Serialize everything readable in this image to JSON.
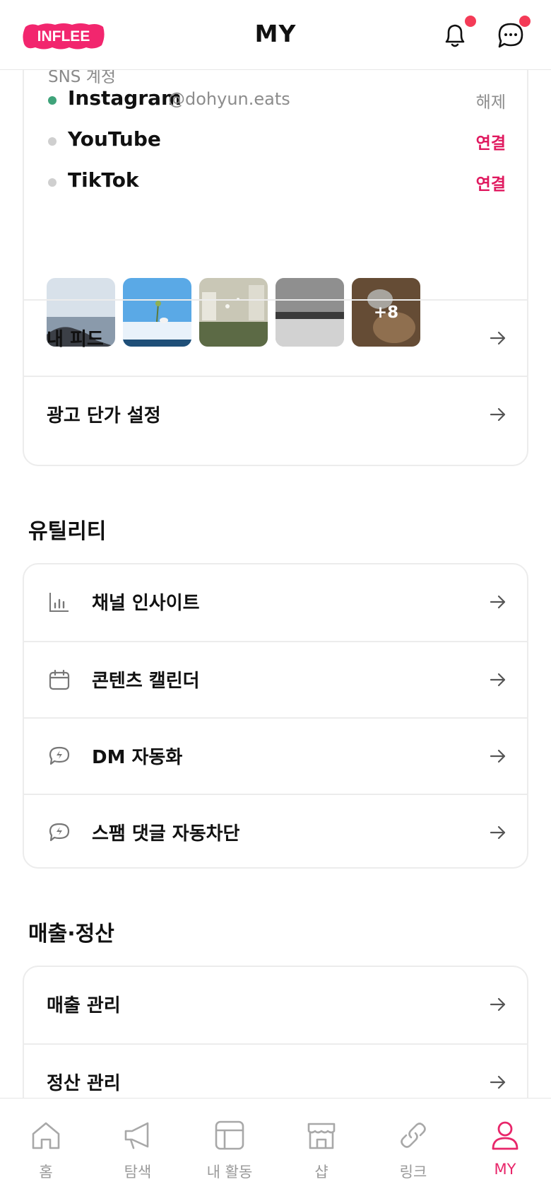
{
  "header": {
    "logo_text": "INFLEE",
    "title": "MY",
    "bell_icon": "bell-icon",
    "chat_icon": "chat-bubble-icon",
    "badge_color": "#f43b57"
  },
  "sns": {
    "label": "SNS 계정",
    "accounts": [
      {
        "name": "Instagram",
        "handle": "@dohyun.eats",
        "action": "해제",
        "connected": true
      },
      {
        "name": "YouTube",
        "handle": "",
        "action": "연결",
        "connected": false
      },
      {
        "name": "TikTok",
        "handle": "",
        "action": "연결",
        "connected": false
      }
    ],
    "more_count": "+8",
    "menu": [
      {
        "label": "내 피드"
      },
      {
        "label": "광고 단가 설정"
      }
    ]
  },
  "utility": {
    "title": "유틸리티",
    "items": [
      {
        "label": "채널 인사이트",
        "icon": "bar-chart-icon"
      },
      {
        "label": "콘텐츠 캘린더",
        "icon": "calendar-icon"
      },
      {
        "label": "DM 자동화",
        "icon": "lightning-chat-icon"
      },
      {
        "label": "스팸 댓글 자동차단",
        "icon": "lightning-chat-icon"
      }
    ]
  },
  "sales": {
    "title": "매출·정산",
    "items": [
      {
        "label": "매출 관리"
      },
      {
        "label": "정산 관리"
      }
    ]
  },
  "tabbar": {
    "active_color": "#e8266a",
    "tabs": [
      {
        "label": "홈",
        "icon": "home-icon"
      },
      {
        "label": "탐색",
        "icon": "megaphone-icon"
      },
      {
        "label": "내 활동",
        "icon": "layout-icon"
      },
      {
        "label": "샵",
        "icon": "store-icon"
      },
      {
        "label": "링크",
        "icon": "link-icon"
      },
      {
        "label": "MY",
        "icon": "person-icon"
      }
    ]
  },
  "colors": {
    "accent": "#e0195f",
    "connected_dot": "#3fa37a",
    "logo_pink": "#f2266e"
  }
}
